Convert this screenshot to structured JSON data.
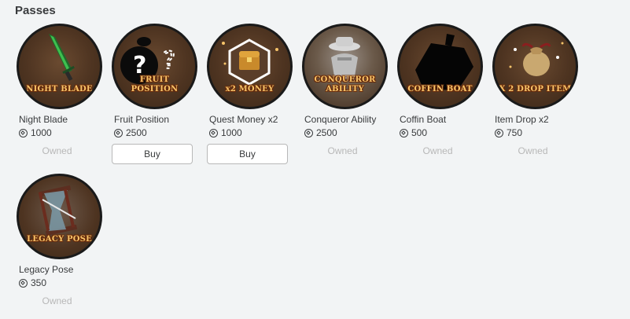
{
  "section": {
    "title": "Passes"
  },
  "passes": [
    {
      "name": "Night Blade",
      "price": "1000",
      "status": "Owned",
      "action": "",
      "art_caption": "NIGHT BLADE",
      "icon": "sword-icon"
    },
    {
      "name": "Fruit Position",
      "price": "2500",
      "status": "",
      "action": "Buy",
      "art_caption": "FRUIT\nPOSITION",
      "icon": "question-fruit-icon"
    },
    {
      "name": "Quest Money x2",
      "price": "1000",
      "status": "",
      "action": "Buy",
      "art_caption": "x2 MONEY",
      "icon": "treasure-chest-icon"
    },
    {
      "name": "Conqueror Ability",
      "price": "2500",
      "status": "Owned",
      "action": "",
      "art_caption": "CONQUEROR\nABILITY",
      "icon": "hat-figure-icon"
    },
    {
      "name": "Coffin Boat",
      "price": "500",
      "status": "Owned",
      "action": "",
      "art_caption": "COFFIN BOAT",
      "icon": "coffin-boat-icon"
    },
    {
      "name": "Item Drop x2",
      "price": "750",
      "status": "Owned",
      "action": "",
      "art_caption": "X 2 DROP ITEM",
      "icon": "loot-bag-icon"
    },
    {
      "name": "Legacy Pose",
      "price": "350",
      "status": "Owned",
      "action": "",
      "art_caption": "LEGACY POSE",
      "icon": "hourglass-icon"
    }
  ],
  "colors": {
    "background": "#f2f4f5",
    "icon_bg": "#4e3421",
    "caption": "#f6c46a",
    "owned_text": "#b8b8b8",
    "text": "#393b3d"
  }
}
